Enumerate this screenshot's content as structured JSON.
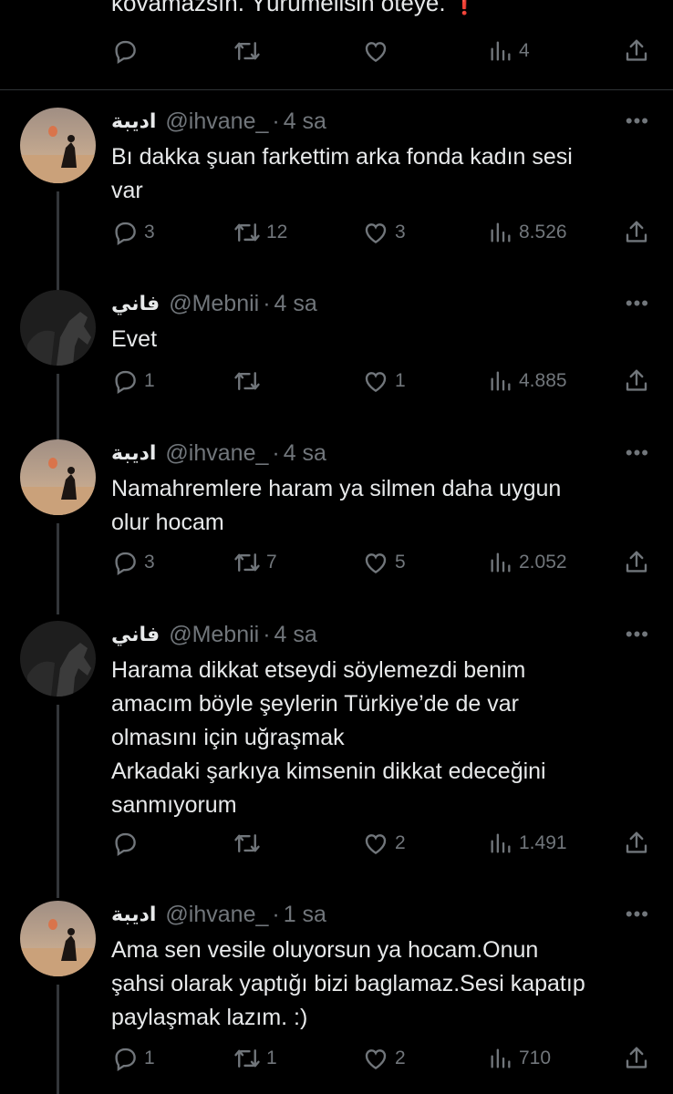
{
  "top": {
    "text": "kovamazsın. Yürümelisin öteye.",
    "pin": "❗",
    "actions": {
      "reply": "",
      "retweet": "",
      "like": "",
      "views": "4"
    }
  },
  "icons": {
    "reply": "reply-icon",
    "retweet": "retweet-icon",
    "like": "heart-icon",
    "views": "views-icon",
    "share": "share-icon",
    "more": "more-icon"
  },
  "colors": {
    "background": "#000000",
    "text": "#e7e9ea",
    "muted": "#71767b",
    "divider": "#2f3336",
    "red": "#f4212e"
  },
  "tweets": [
    {
      "name": "اديبة",
      "handle": "@ihvane_",
      "dot": "·",
      "time": "4 sa",
      "more": "•••",
      "lines": [
        "Bı dakka şuan farkettim arka fonda kadın sesi",
        "var"
      ],
      "reply": "3",
      "retweet": "12",
      "like": "3",
      "views": "8.526"
    },
    {
      "name": "فاني",
      "handle": "@Mebnii",
      "dot": "·",
      "time": "4 sa",
      "more": "•••",
      "lines": [
        "Evet"
      ],
      "reply": "1",
      "retweet": "",
      "like": "1",
      "views": "4.885"
    },
    {
      "name": "اديبة",
      "handle": "@ihvane_",
      "dot": "·",
      "time": "4 sa",
      "more": "•••",
      "lines": [
        "Namahremlere haram ya silmen daha uygun",
        "olur hocam"
      ],
      "reply": "3",
      "retweet": "7",
      "like": "5",
      "views": "2.052"
    },
    {
      "name": "فاني",
      "handle": "@Mebnii",
      "dot": "·",
      "time": "4 sa",
      "more": "•••",
      "lines": [
        "Harama dikkat etseydi söylemezdi benim",
        "amacım böyle şeylerin Türkiye’de de var",
        "olmasını için uğraşmak",
        "Arkadaki şarkıya kimsenin dikkat edeceğini",
        "sanmıyorum"
      ],
      "reply": "",
      "retweet": "",
      "like": "2",
      "views": "1.491"
    },
    {
      "name": "اديبة",
      "handle": "@ihvane_",
      "dot": "·",
      "time": "1 sa",
      "more": "•••",
      "lines": [
        "Ama sen vesile oluyorsun ya hocam.Onun",
        "şahsi olarak yaptığı bizi baglamaz.Sesi kapatıp",
        "paylaşmak lazım. :)"
      ],
      "reply": "1",
      "retweet": "1",
      "like": "2",
      "views": "710"
    }
  ]
}
